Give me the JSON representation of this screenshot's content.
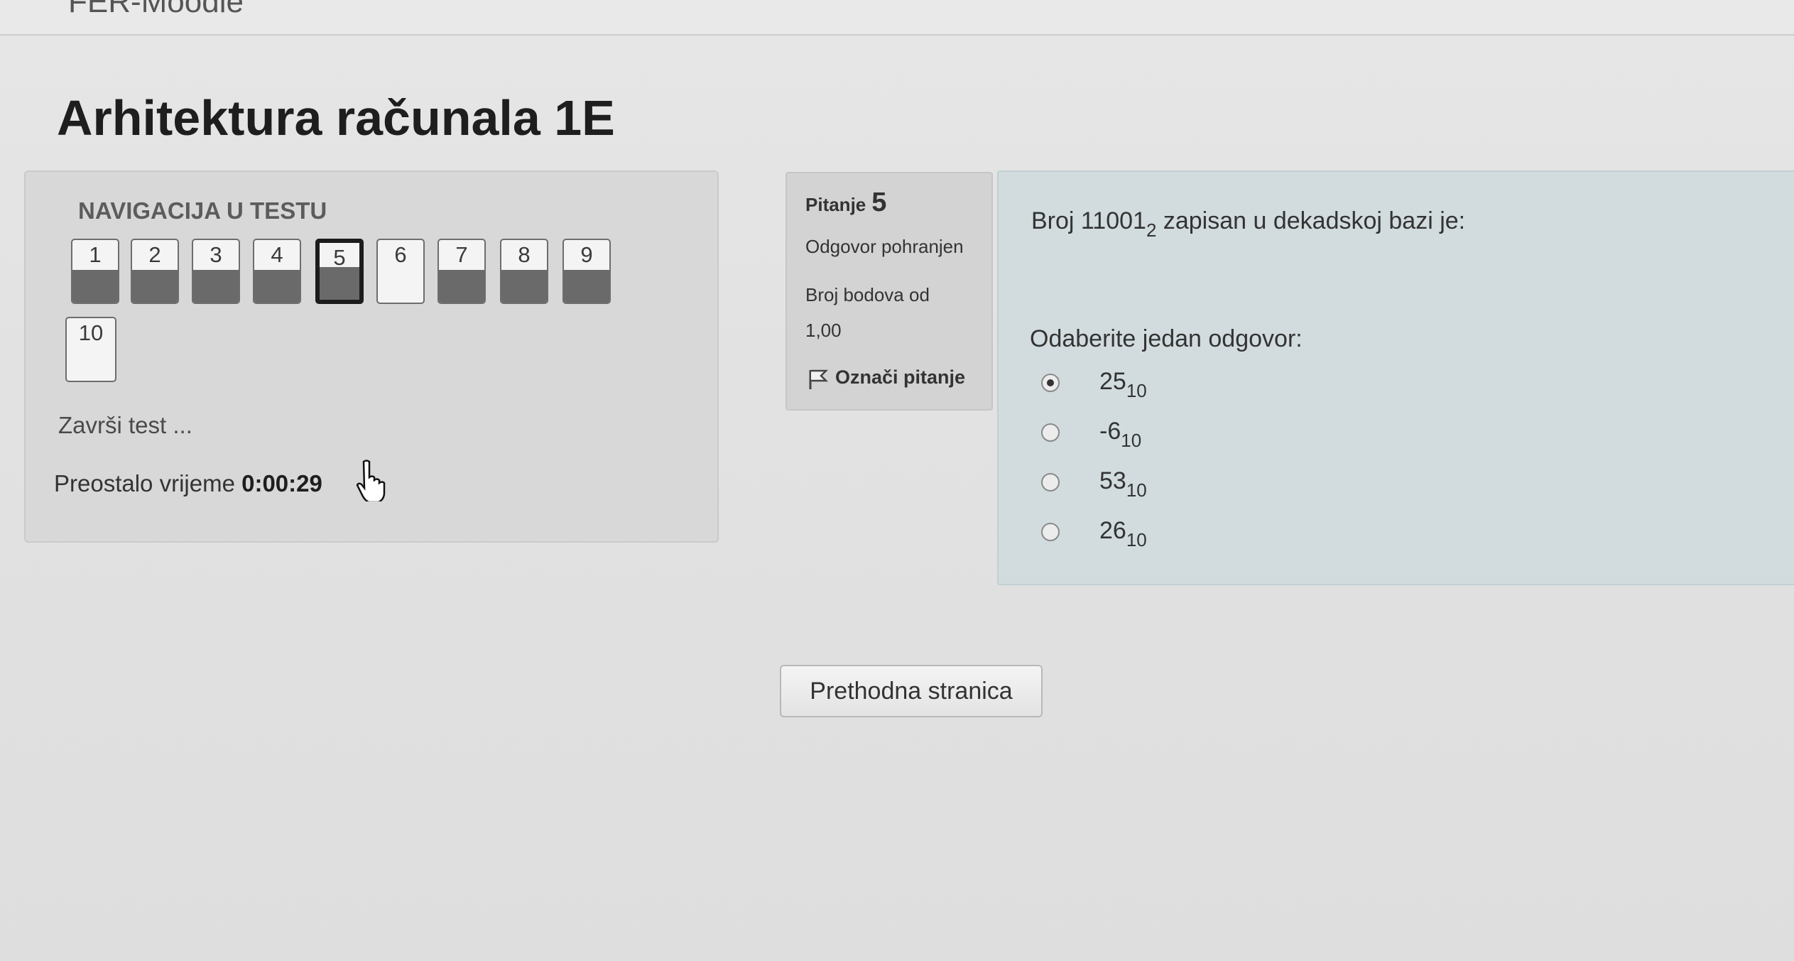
{
  "site": {
    "name": "FER-Moodle"
  },
  "course": {
    "title": "Arhitektura računala 1E"
  },
  "navigation": {
    "heading": "NAVIGACIJA U TESTU",
    "questions": [
      "1",
      "2",
      "3",
      "4",
      "5",
      "6",
      "7",
      "8",
      "9",
      "10"
    ],
    "finish_label": "Završi test ...",
    "time_left_label": "Preostalo vrijeme",
    "time_left_value": "0:00:29"
  },
  "question_info": {
    "label": "Pitanje",
    "number": "5",
    "status": "Odgovor pohranjen",
    "points_label": "Broj bodova od",
    "points_value": "1,00",
    "flag_label": "Označi pitanje",
    "flag_icon": "flag-icon"
  },
  "question": {
    "text_before": "Broj 11001",
    "text_base": "2",
    "text_after": " zapisan u dekadskoj bazi je:",
    "prompt": "Odaberite jedan odgovor:",
    "options": [
      {
        "value": "25",
        "base": "10",
        "selected": true
      },
      {
        "value": "-6",
        "base": "10",
        "selected": false
      },
      {
        "value": "53",
        "base": "10",
        "selected": false
      },
      {
        "value": "26",
        "base": "10",
        "selected": false
      }
    ]
  },
  "buttons": {
    "prev_page": "Prethodna stranica"
  }
}
